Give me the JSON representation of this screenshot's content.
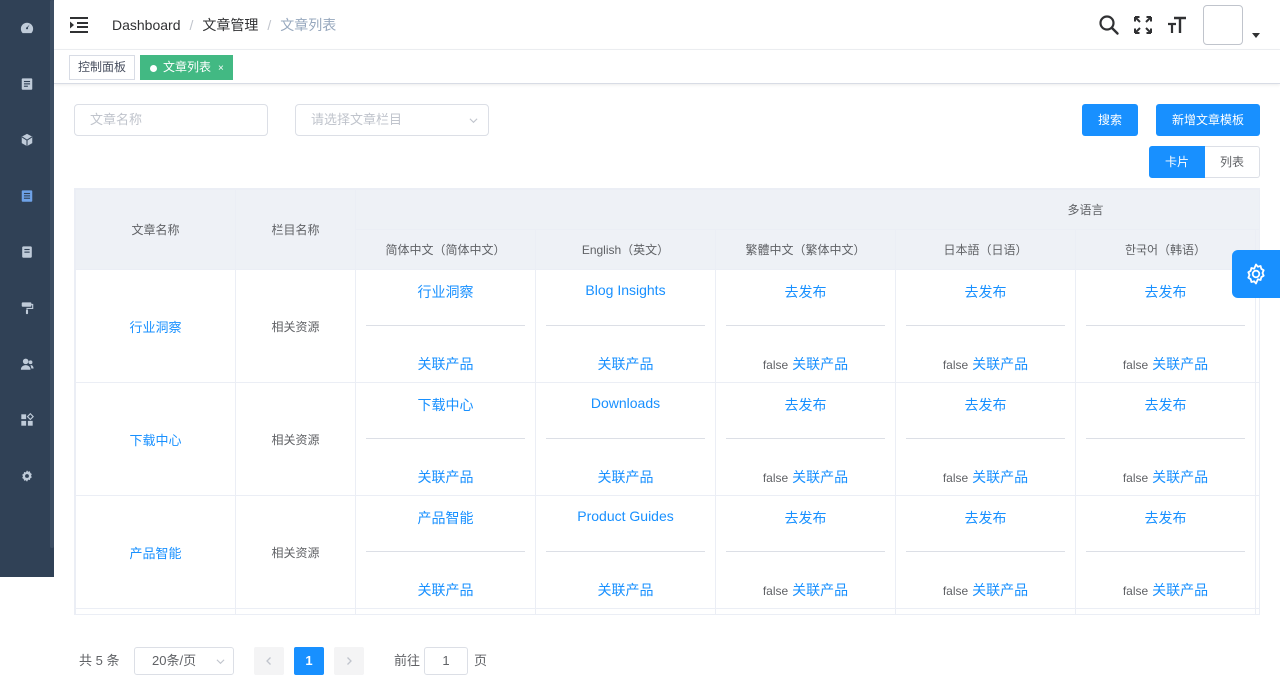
{
  "sidebar": {
    "items": [
      {
        "icon": "dashboard-icon"
      },
      {
        "icon": "document-icon"
      },
      {
        "icon": "cube-icon"
      },
      {
        "icon": "article-icon",
        "active": true
      },
      {
        "icon": "book-icon"
      },
      {
        "icon": "brush-icon"
      },
      {
        "icon": "users-icon"
      },
      {
        "icon": "grid-icon"
      },
      {
        "icon": "gear-icon"
      }
    ],
    "bg_color": "#304156",
    "active_color": "#1890ff"
  },
  "navbar": {
    "breadcrumb": [
      "Dashboard",
      "文章管理",
      "文章列表"
    ],
    "separator": "/",
    "icons": [
      "search-icon",
      "fullscreen-icon",
      "font-size-icon"
    ]
  },
  "tags": [
    {
      "label": "控制面板",
      "active": false
    },
    {
      "label": "文章列表",
      "active": true,
      "close": "×"
    }
  ],
  "filters": {
    "name_placeholder": "文章名称",
    "category_placeholder": "请选择文章栏目",
    "search_label": "搜索",
    "add_label": "新增文章模板",
    "view_card_label": "卡片",
    "view_list_label": "列表"
  },
  "table": {
    "headers": {
      "name": "文章名称",
      "column": "栏目名称",
      "multilang": "多语言",
      "langs": [
        "简体中文（简体中文）",
        "English（英文）",
        "繁體中文（繁体中文）",
        "日本語（日语）",
        "한국어（韩语）"
      ]
    },
    "rows": [
      {
        "name": "行业洞察",
        "column": "相关资源",
        "cells": [
          {
            "top": "行业洞察",
            "prefix": "",
            "bottom": "关联产品"
          },
          {
            "top": "Blog Insights",
            "prefix": "",
            "bottom": "关联产品"
          },
          {
            "top": "去发布",
            "prefix": "false",
            "bottom": "关联产品"
          },
          {
            "top": "去发布",
            "prefix": "false",
            "bottom": "关联产品"
          },
          {
            "top": "去发布",
            "prefix": "false",
            "bottom": "关联产品"
          }
        ]
      },
      {
        "name": "下载中心",
        "column": "相关资源",
        "cells": [
          {
            "top": "下载中心",
            "prefix": "",
            "bottom": "关联产品"
          },
          {
            "top": "Downloads",
            "prefix": "",
            "bottom": "关联产品"
          },
          {
            "top": "去发布",
            "prefix": "false",
            "bottom": "关联产品"
          },
          {
            "top": "去发布",
            "prefix": "false",
            "bottom": "关联产品"
          },
          {
            "top": "去发布",
            "prefix": "false",
            "bottom": "关联产品"
          }
        ]
      },
      {
        "name": "产品智能",
        "column": "相关资源",
        "cells": [
          {
            "top": "产品智能",
            "prefix": "",
            "bottom": "关联产品"
          },
          {
            "top": "Product Guides",
            "prefix": "",
            "bottom": "关联产品"
          },
          {
            "top": "去发布",
            "prefix": "false",
            "bottom": "关联产品"
          },
          {
            "top": "去发布",
            "prefix": "false",
            "bottom": "关联产品"
          },
          {
            "top": "去发布",
            "prefix": "false",
            "bottom": "关联产品"
          }
        ]
      }
    ]
  },
  "pagination": {
    "total_text": "共 5 条",
    "page_size": "20条/页",
    "current_page": "1",
    "goto_prefix": "前往",
    "goto_value": "1",
    "goto_suffix": "页"
  }
}
